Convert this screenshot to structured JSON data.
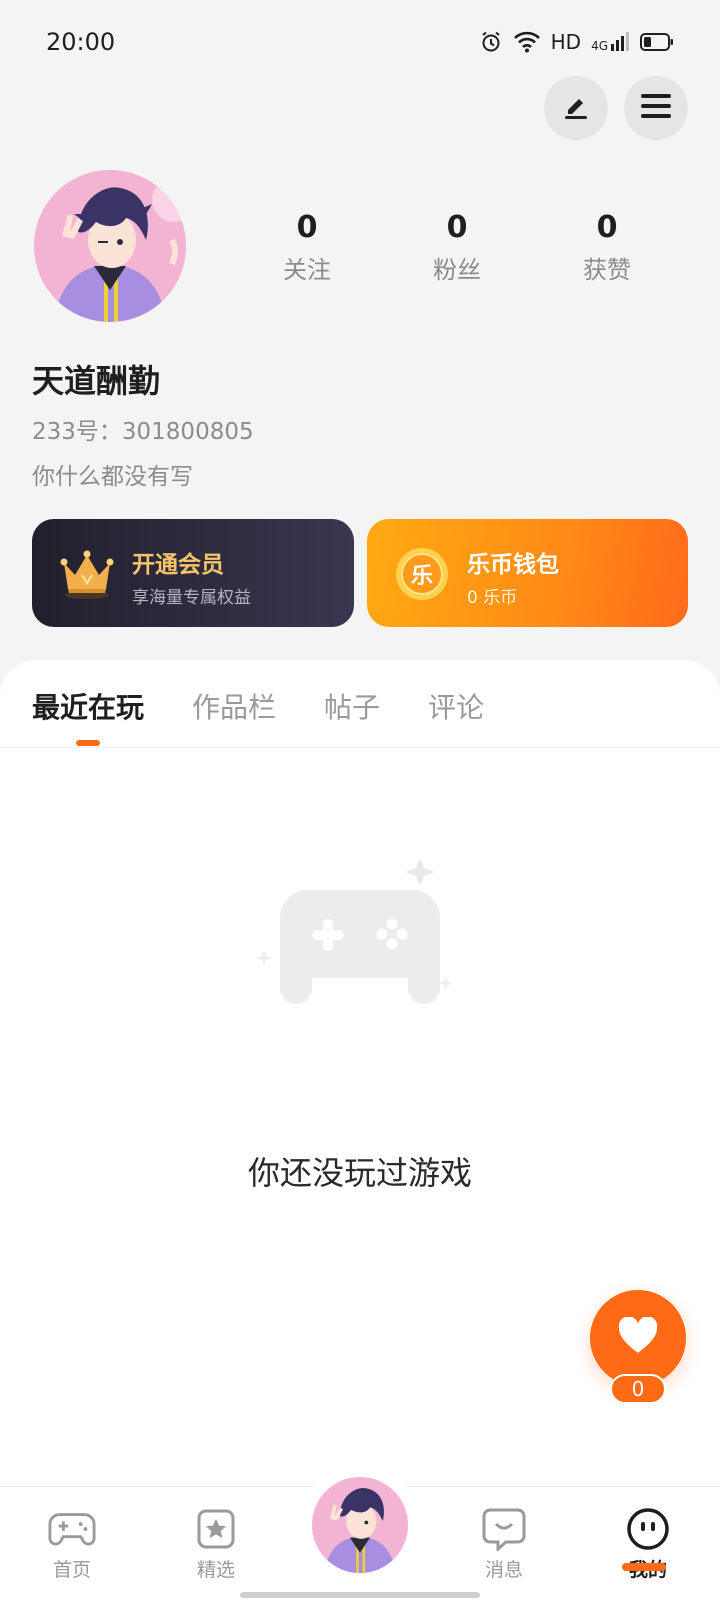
{
  "status_bar": {
    "time": "20:00",
    "network_label": "HD",
    "cellular_label": "4G"
  },
  "header": {
    "edit_icon": "pencil-icon",
    "menu_icon": "menu-icon"
  },
  "profile": {
    "stats": [
      {
        "value": "0",
        "label": "关注"
      },
      {
        "value": "0",
        "label": "粉丝"
      },
      {
        "value": "0",
        "label": "获赞"
      }
    ],
    "username": "天道酬勤",
    "uid": "233号：301800805",
    "bio": "你什么都没有写"
  },
  "cards": {
    "vip": {
      "title": "开通会员",
      "subtitle": "享海量专属权益",
      "icon": "crown-icon",
      "accent": "#f6c56b"
    },
    "wallet": {
      "title": "乐币钱包",
      "subtitle": "0 乐币",
      "icon_text": "乐",
      "icon": "coin-icon"
    }
  },
  "tabs": [
    {
      "label": "最近在玩",
      "active": true
    },
    {
      "label": "作品栏",
      "active": false
    },
    {
      "label": "帖子",
      "active": false
    },
    {
      "label": "评论",
      "active": false
    }
  ],
  "empty_state": {
    "icon": "gamepad-icon",
    "text": "你还没玩过游戏"
  },
  "like_fab": {
    "icon": "heart-icon",
    "count": "0"
  },
  "bottom_nav": [
    {
      "label": "首页",
      "icon": "gamepad-icon",
      "active": false
    },
    {
      "label": "精选",
      "icon": "star-icon",
      "active": false
    },
    {
      "label": "消息",
      "icon": "chat-icon",
      "active": false
    },
    {
      "label": "我的",
      "icon": "face-icon",
      "active": true
    }
  ],
  "colors": {
    "accent": "#ff6a14",
    "background": "#f5f4f5"
  }
}
